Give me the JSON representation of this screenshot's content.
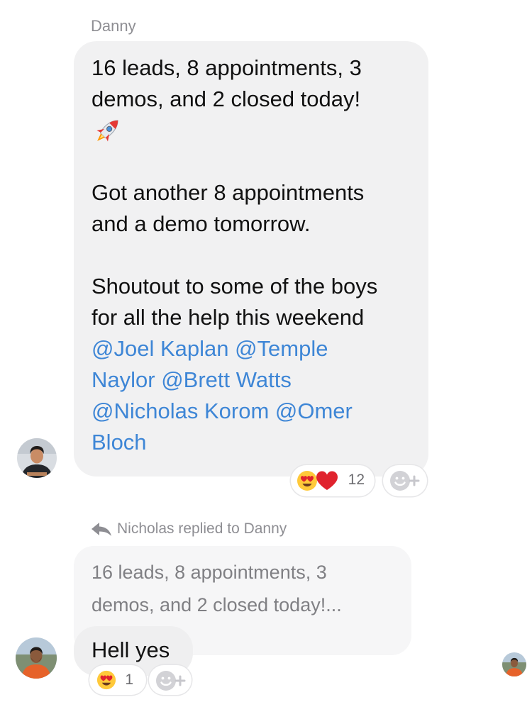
{
  "thread": {
    "sender_name": "Danny",
    "message": {
      "line1": "16 leads, 8 appointments, 3",
      "line2": "demos, and 2 closed today!",
      "emoji_icon": "rocket-icon",
      "line3": "Got another 8 appointments",
      "line4": "and a demo tomorrow.",
      "line5": "Shoutout to some of the boys",
      "line6": "for all the help this weekend",
      "mention_line1": "@Joel Kaplan @Temple",
      "mention_line2": "Naylor @Brett Watts",
      "mention_line3": "@Nicholas Korom @Omer",
      "mention_line4": "Bloch"
    },
    "reactions": {
      "icons": [
        "heart-eyes-emoji",
        "red-heart-emoji"
      ],
      "count": "12"
    },
    "reply": {
      "header": "Nicholas replied to Danny",
      "quoted_line1": "16 leads, 8 appointments, 3",
      "quoted_line2": "demos, and 2 closed today!...",
      "text": "Hell yes",
      "reactions": {
        "icons": [
          "heart-eyes-emoji"
        ],
        "count": "1"
      }
    }
  },
  "colors": {
    "bubble_gray": "#f1f1f2",
    "mention_blue": "#3e86d6",
    "meta_gray": "#8e8e93",
    "heart_red": "#e0232e",
    "emoji_yellow": "#ffc93a"
  }
}
